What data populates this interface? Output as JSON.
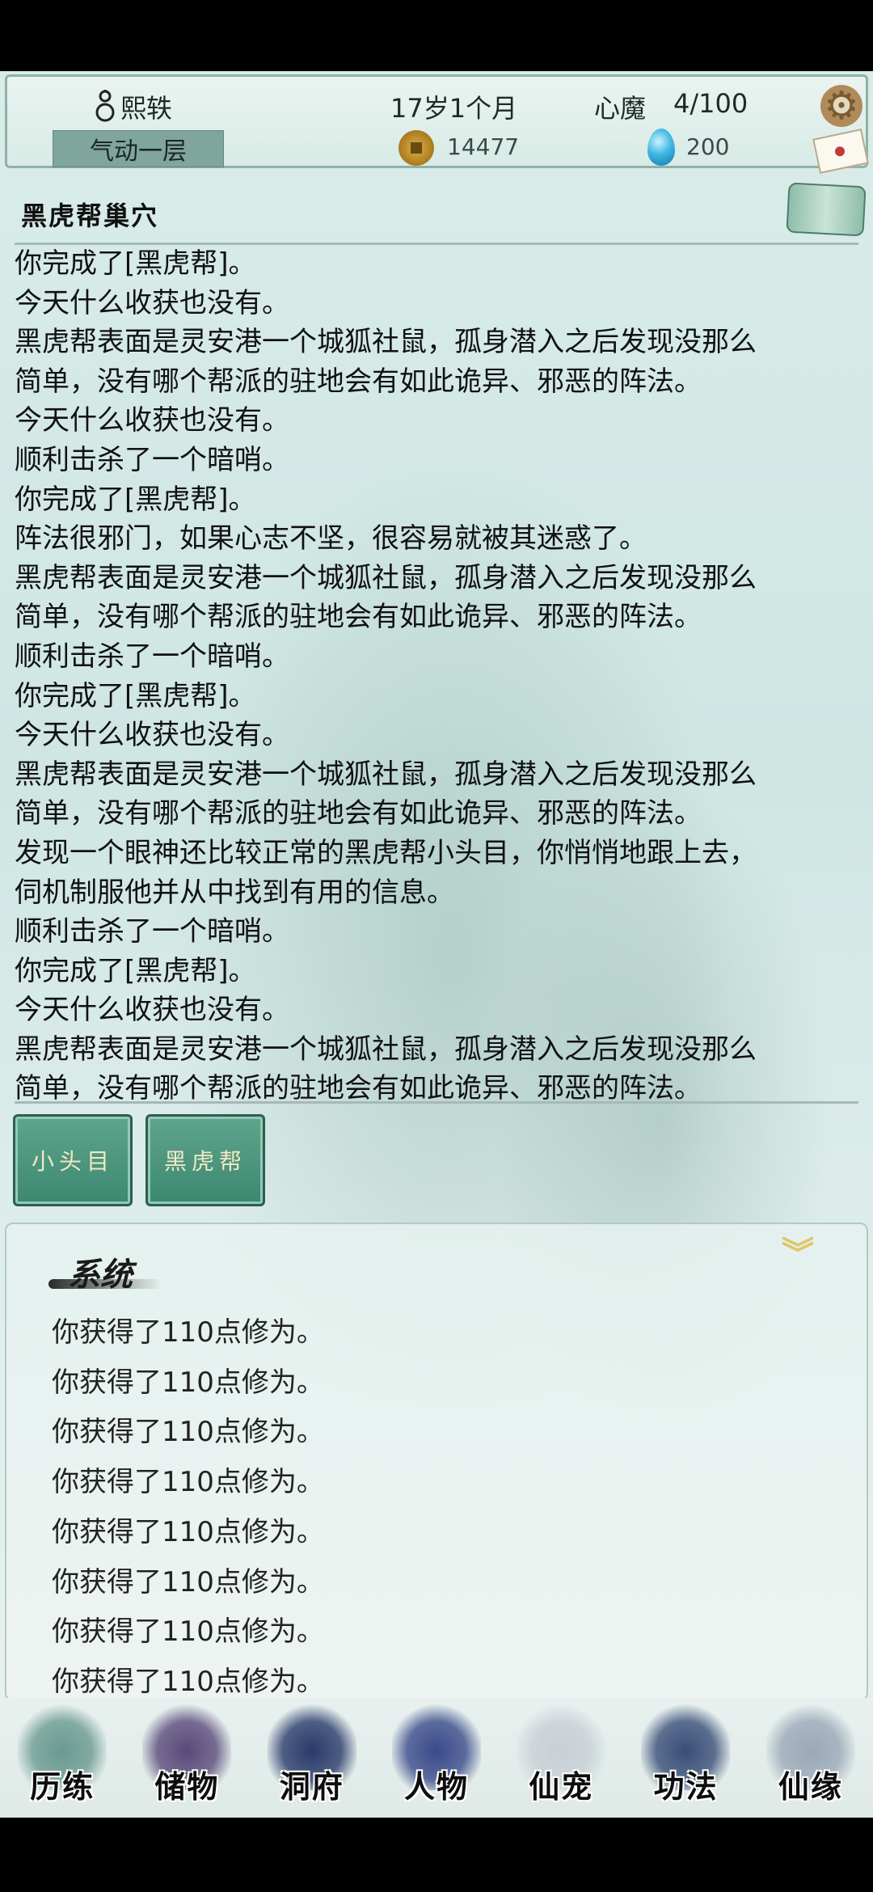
{
  "header": {
    "player_name": "熙轶",
    "realm": "气动一层",
    "age": "17岁1个月",
    "heart_demon_label": "心魔",
    "heart_demon_value": "4/100",
    "coins": "14477",
    "spirit_stones": "200"
  },
  "location": {
    "title": "黑虎帮巢穴"
  },
  "log": [
    "你完成了[黑虎帮]。",
    "今天什么收获也没有。",
    "黑虎帮表面是灵安港一个城狐社鼠，孤身潜入之后发现没那么",
    "简单，没有哪个帮派的驻地会有如此诡异、邪恶的阵法。",
    "今天什么收获也没有。",
    "顺利击杀了一个暗哨。",
    "你完成了[黑虎帮]。",
    "阵法很邪门，如果心志不坚，很容易就被其迷惑了。",
    "黑虎帮表面是灵安港一个城狐社鼠，孤身潜入之后发现没那么",
    "简单，没有哪个帮派的驻地会有如此诡异、邪恶的阵法。",
    "顺利击杀了一个暗哨。",
    "你完成了[黑虎帮]。",
    "今天什么收获也没有。",
    "黑虎帮表面是灵安港一个城狐社鼠，孤身潜入之后发现没那么",
    "简单，没有哪个帮派的驻地会有如此诡异、邪恶的阵法。",
    "发现一个眼神还比较正常的黑虎帮小头目，你悄悄地跟上去，",
    "伺机制服他并从中找到有用的信息。",
    "顺利击杀了一个暗哨。",
    "你完成了[黑虎帮]。",
    "今天什么收获也没有。",
    "黑虎帮表面是灵安港一个城狐社鼠，孤身潜入之后发现没那么",
    "简单，没有哪个帮派的驻地会有如此诡异、邪恶的阵法。"
  ],
  "actions": {
    "btn1": "小头目",
    "btn2": "黑虎帮"
  },
  "system": {
    "title": "系统",
    "messages": [
      "你获得了110点修为。",
      "你获得了110点修为。",
      "你获得了110点修为。",
      "你获得了110点修为。",
      "你获得了110点修为。",
      "你获得了110点修为。",
      "你获得了110点修为。",
      "你获得了110点修为。"
    ]
  },
  "nav": [
    {
      "label": "历练",
      "icon": "mountain-icon",
      "color": "#6a9a90"
    },
    {
      "label": "储物",
      "icon": "bag-icon",
      "color": "#5a4a7a"
    },
    {
      "label": "洞府",
      "icon": "palace-icon",
      "color": "#2a3a6a"
    },
    {
      "label": "人物",
      "icon": "person-icon",
      "color": "#3a4a8a"
    },
    {
      "label": "仙宠",
      "icon": "ghost-pet-icon",
      "color": "#c8d0d6"
    },
    {
      "label": "功法",
      "icon": "book-icon",
      "color": "#3a4e78"
    },
    {
      "label": "仙缘",
      "icon": "crane-icon",
      "color": "#9aa8b8"
    }
  ]
}
